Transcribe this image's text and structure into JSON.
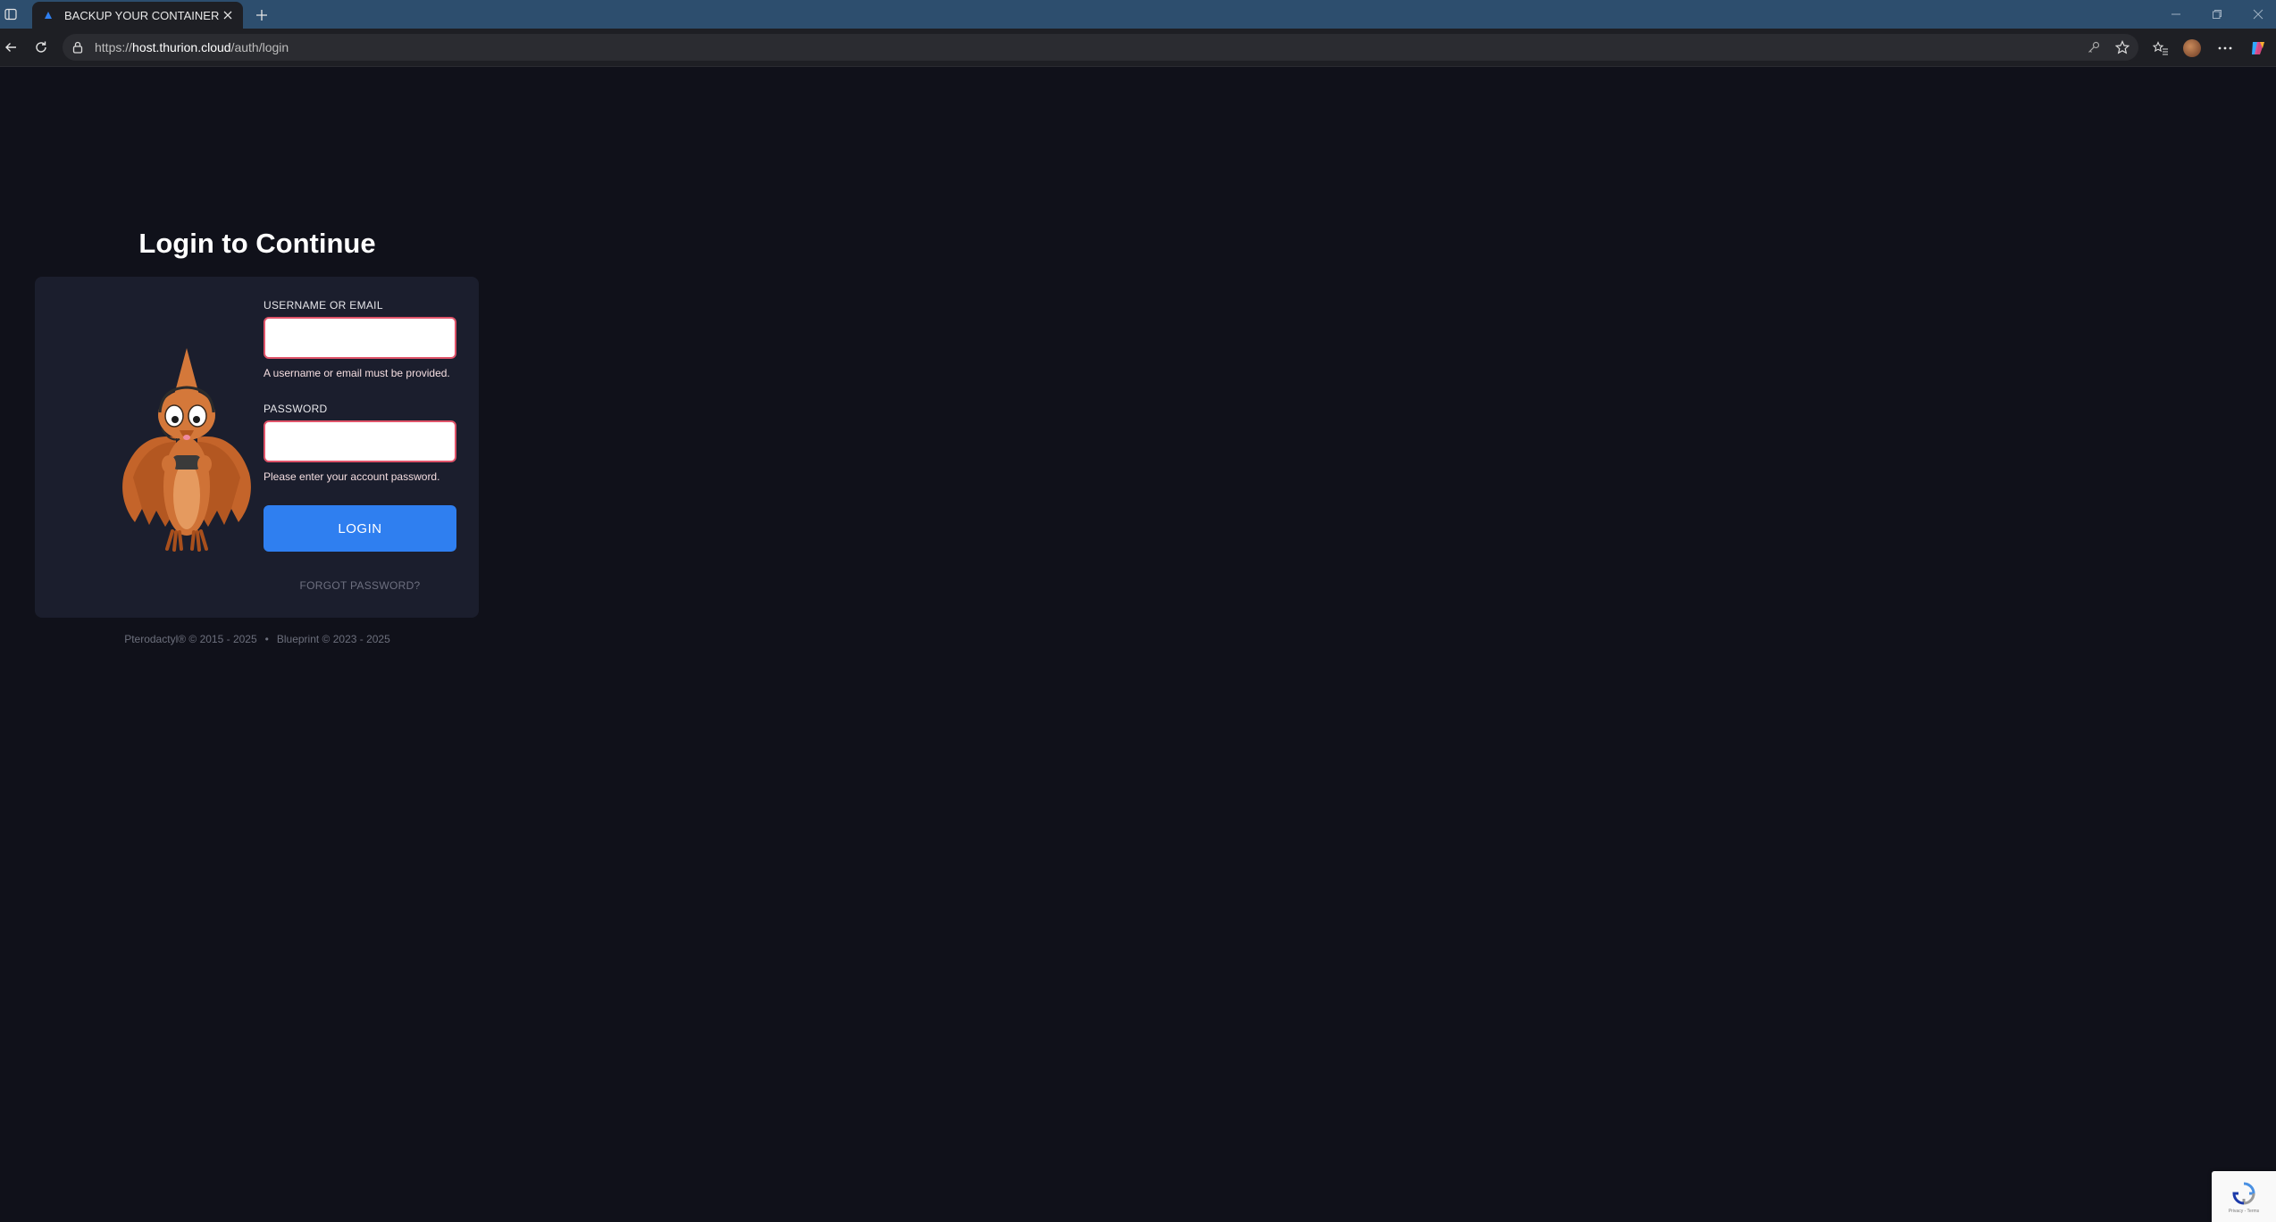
{
  "browser": {
    "tab_title": "BACKUP YOUR CONTAINER IDIOT",
    "url_prefix": "https://",
    "url_host": "host.thurion.cloud",
    "url_path": "/auth/login"
  },
  "login": {
    "title": "Login to Continue",
    "username_label": "USERNAME OR EMAIL",
    "username_value": "",
    "username_error": "A username or email must be provided.",
    "password_label": "PASSWORD",
    "password_value": "",
    "password_error": "Please enter your account password.",
    "login_button": "LOGIN",
    "forgot_password": "FORGOT PASSWORD?"
  },
  "footer": {
    "pterodactyl": "Pterodactyl® © 2015 - 2025",
    "separator": "•",
    "blueprint": "Blueprint © 2023 - 2025"
  },
  "recaptcha": {
    "terms": "Privacy - Terms"
  },
  "colors": {
    "page_bg": "#10111a",
    "card_bg": "#1b1e2d",
    "accent": "#2f7ff0",
    "error_border": "#e0546a",
    "tabbar": "#2d4e6e"
  },
  "icons": {
    "sidebar": "sidebar-toggle-icon",
    "favicon": "favicon-icon",
    "close": "close-icon",
    "new_tab": "plus-icon",
    "back": "back-arrow-icon",
    "refresh": "refresh-icon",
    "lock": "lock-icon",
    "key": "key-icon",
    "star": "star-icon",
    "favorites": "favorites-icon",
    "profile": "avatar",
    "more": "more-icon",
    "copilot": "copilot-icon"
  }
}
